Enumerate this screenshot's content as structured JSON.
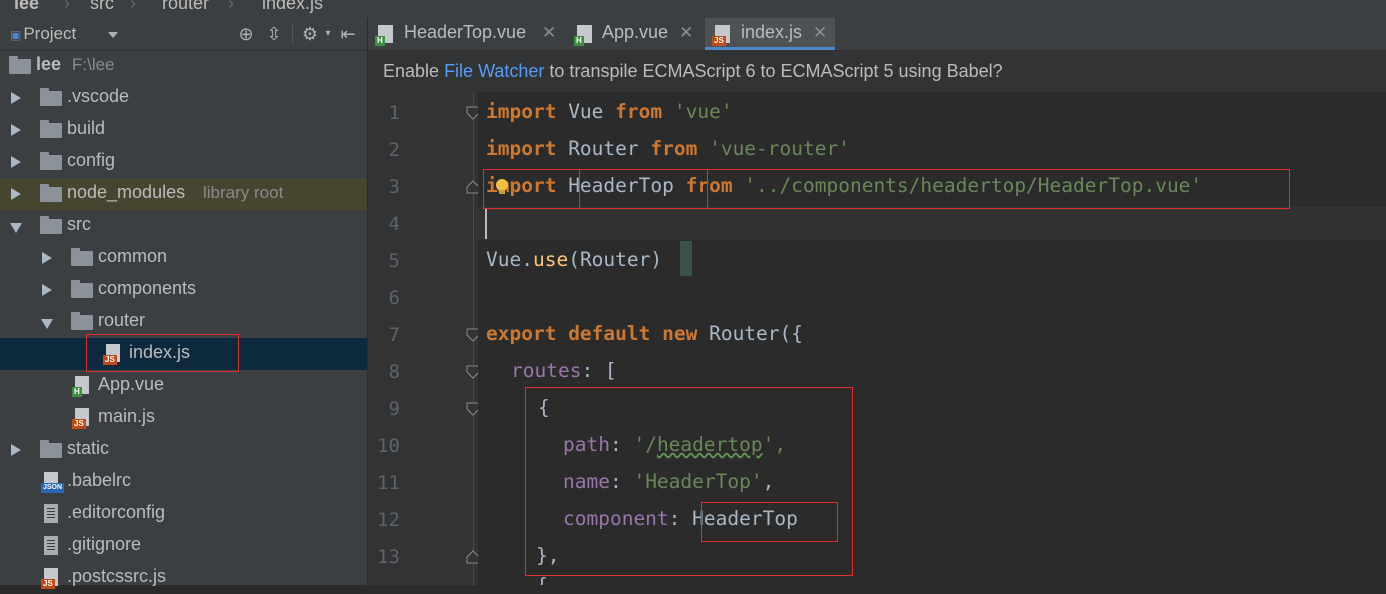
{
  "breadcrumb": [
    {
      "label": "lee",
      "icon": "folder-icon"
    },
    {
      "label": "src",
      "icon": "folder-icon"
    },
    {
      "label": "router",
      "icon": "folder-icon"
    },
    {
      "label": "index.js",
      "icon": "js-file-icon"
    }
  ],
  "project_panel": {
    "title": "Project",
    "tools": [
      "target-icon",
      "collapse-icon",
      "gear-icon",
      "hide-icon"
    ],
    "root": {
      "name": "lee",
      "path": "F:\\lee"
    },
    "tree": [
      {
        "label": "lee",
        "sub": "F:\\lee",
        "type": "folder",
        "depth": 0,
        "state": "root"
      },
      {
        "label": ".vscode",
        "type": "folder",
        "depth": 1,
        "state": "collapsed"
      },
      {
        "label": "build",
        "type": "folder",
        "depth": 1,
        "state": "collapsed"
      },
      {
        "label": "config",
        "type": "folder",
        "depth": 1,
        "state": "collapsed"
      },
      {
        "label": "node_modules",
        "sub": "library root",
        "type": "folder",
        "depth": 1,
        "state": "collapsed"
      },
      {
        "label": "src",
        "type": "folder",
        "depth": 1,
        "state": "expanded"
      },
      {
        "label": "common",
        "type": "folder",
        "depth": 2,
        "state": "collapsed"
      },
      {
        "label": "components",
        "type": "folder",
        "depth": 2,
        "state": "collapsed"
      },
      {
        "label": "router",
        "type": "folder",
        "depth": 2,
        "state": "expanded"
      },
      {
        "label": "index.js",
        "type": "js",
        "depth": 3,
        "state": "selected"
      },
      {
        "label": "App.vue",
        "type": "vue",
        "depth": 2,
        "state": "leaf"
      },
      {
        "label": "main.js",
        "type": "js",
        "depth": 2,
        "state": "leaf"
      },
      {
        "label": "static",
        "type": "folder",
        "depth": 1,
        "state": "collapsed"
      },
      {
        "label": ".babelrc",
        "type": "json",
        "depth": 1,
        "state": "leaf"
      },
      {
        "label": ".editorconfig",
        "type": "text",
        "depth": 1,
        "state": "leaf"
      },
      {
        "label": ".gitignore",
        "type": "text",
        "depth": 1,
        "state": "leaf"
      },
      {
        "label": ".postcssrc.js",
        "type": "js",
        "depth": 1,
        "state": "leaf"
      }
    ]
  },
  "tabs": [
    {
      "label": "HeaderTop.vue",
      "type": "vue",
      "active": false
    },
    {
      "label": "App.vue",
      "type": "vue",
      "active": false
    },
    {
      "label": "index.js",
      "type": "js",
      "active": true
    }
  ],
  "notice": {
    "prefix": "Enable ",
    "link": "File Watcher",
    "suffix": " to transpile ECMAScript 6 to ECMAScript 5 using Babel?"
  },
  "editor": {
    "line_numbers": [
      "1",
      "2",
      "3",
      "4",
      "5",
      "6",
      "7",
      "8",
      "9",
      "10",
      "11",
      "12",
      "13"
    ],
    "code": {
      "l1_kw": "import",
      "l1_id": " Vue ",
      "l1_from": "from",
      "l1_str": " 'vue'",
      "l2_kw": "import",
      "l2_id": " Router ",
      "l2_from": "from",
      "l2_str": " 'vue-router'",
      "l3_kw": "import",
      "l3_id": " HeaderTop ",
      "l3_from": "from",
      "l3_str": " '../components/headertop/HeaderTop.vue'",
      "l5_obj": "Vue.",
      "l5_fn": "use",
      "l5_arg": "(Router)",
      "l7_k1": "export",
      "l7_k2": " default",
      "l7_k3": " new",
      "l7_rest": " Router({",
      "l8_prop": "routes",
      "l8_rest": ": [",
      "l9": "{",
      "l10_prop": "path",
      "l10_colon": ": ",
      "l10_q1": "'/",
      "l10_word": "headertop",
      "l10_q2": "',",
      "l11_prop": "name",
      "l11_colon": ": ",
      "l11_str": "'HeaderTop'",
      "l11_comma": ",",
      "l12_prop": "component",
      "l12_colon": ": ",
      "l12_val": "HeaderTop",
      "l13": "},",
      "l14": "{"
    }
  },
  "colors": {
    "keyword": "#cc7832",
    "string": "#6a8759",
    "function": "#ffc66d",
    "property": "#9876aa",
    "text": "#a9b7c6",
    "link": "#589df6",
    "highlight_box": "#e02d2d"
  }
}
